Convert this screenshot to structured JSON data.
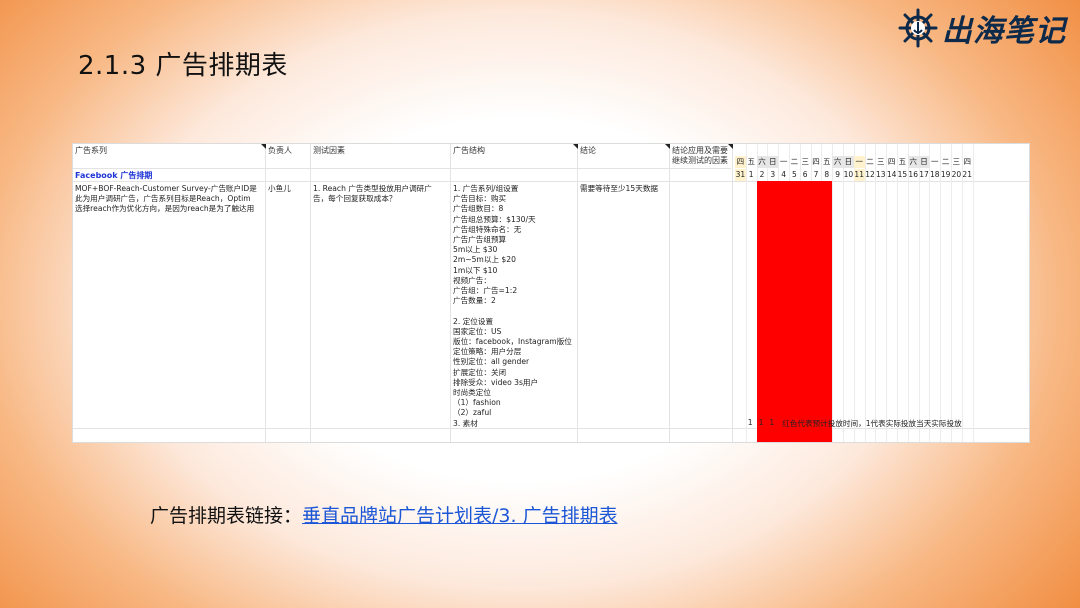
{
  "slide": {
    "title": "2.1.3 广告排期表",
    "logo_text": "出海笔记"
  },
  "sheet": {
    "headers": {
      "series": "广告系列",
      "owner": "负责人",
      "test_factor": "测试因素",
      "structure": "广告结构",
      "conclusion": "结论",
      "applied": "结论应用及需要继续测试的因素"
    },
    "section_title": "Facebook 广告排期",
    "row": {
      "series_lines": [
        "MOF+BOF-Reach-Customer Survey-广告账户ID是",
        "此为用户调研广告，广告系列目标是Reach，Optim",
        "选择reach作为优化方向，是因为reach是为了触达用"
      ],
      "owner": "小鱼儿",
      "test_factor_lines": [
        "1. Reach 广告类型投放用户调研广",
        "告，每个回复获取成本？"
      ],
      "structure_lines": [
        "1. 广告系列/组设置",
        "广告目标：购买",
        "广告组数目：8",
        "广告组总预算：$130/天",
        "广告组特殊命名：无",
        "广告广告组预算",
        "5m以上 $30",
        "2m~5m以上 $20",
        "1m以下 $10",
        "视频广告：",
        "广告组：广告=1:2",
        "广告数量：2",
        "",
        "2. 定位设置",
        "国家定位：US",
        "版位：facebook，Instagram版位",
        "定位策略：用户分层",
        "性别定位：all gender",
        "扩展定位：关闭",
        "排除受众：video 3s用户",
        "时尚类定位",
        "（1）fashion",
        "（2）zaful",
        "3. 素材"
      ],
      "conclusion": "需要等待至少15天数据"
    },
    "calendar": {
      "weekdays": [
        "四",
        "五",
        "六",
        "日",
        "一",
        "二",
        "三",
        "四",
        "五",
        "六",
        "日",
        "一",
        "二",
        "三",
        "四",
        "五",
        "六",
        "日",
        "一",
        "二",
        "三",
        "四"
      ],
      "dates": [
        "31",
        "1",
        "2",
        "3",
        "4",
        "5",
        "6",
        "7",
        "8",
        "9",
        "10",
        "11",
        "12",
        "13",
        "14",
        "15",
        "16",
        "17",
        "18",
        "19",
        "20",
        "21"
      ],
      "note_nums": [
        "1",
        "1",
        "1"
      ],
      "note": "红色代表预计投放时间，1代表实际投放当天实际投放",
      "colors": {
        "weekend_header": "#e6e6e6",
        "highlight_header": "#fff2cc",
        "planned": "#ff0000"
      }
    }
  },
  "footer": {
    "label": "广告排期表链接：",
    "link_text": "垂直品牌站广告计划表/3. 广告排期表"
  }
}
